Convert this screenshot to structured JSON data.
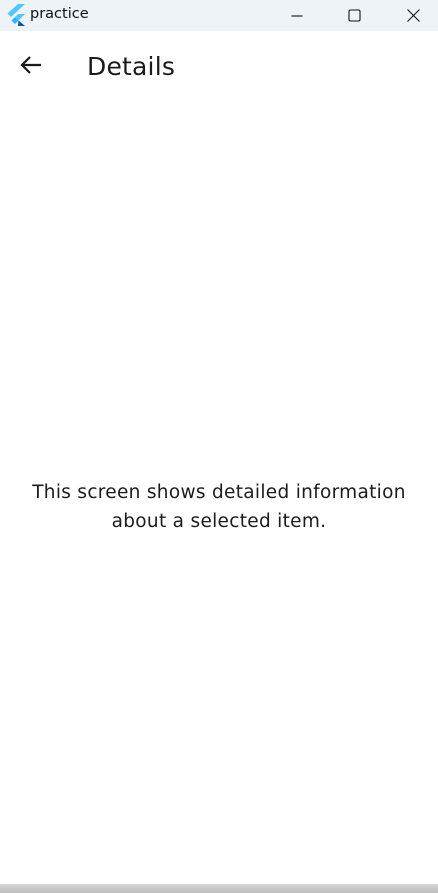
{
  "window": {
    "title": "practice",
    "controls": {
      "minimize_icon": "minimize-icon",
      "maximize_icon": "maximize-icon",
      "close_icon": "close-icon"
    }
  },
  "appbar": {
    "back_icon": "arrow-left-icon",
    "title": "Details"
  },
  "body": {
    "text": "This screen shows detailed information about a selected item."
  },
  "colors": {
    "titlebar_bg": "#eef3f8",
    "page_bg": "#ffffff",
    "text": "#1b1b1f",
    "flutter_blue_light": "#54c5f8",
    "flutter_blue_dark": "#01579b"
  }
}
